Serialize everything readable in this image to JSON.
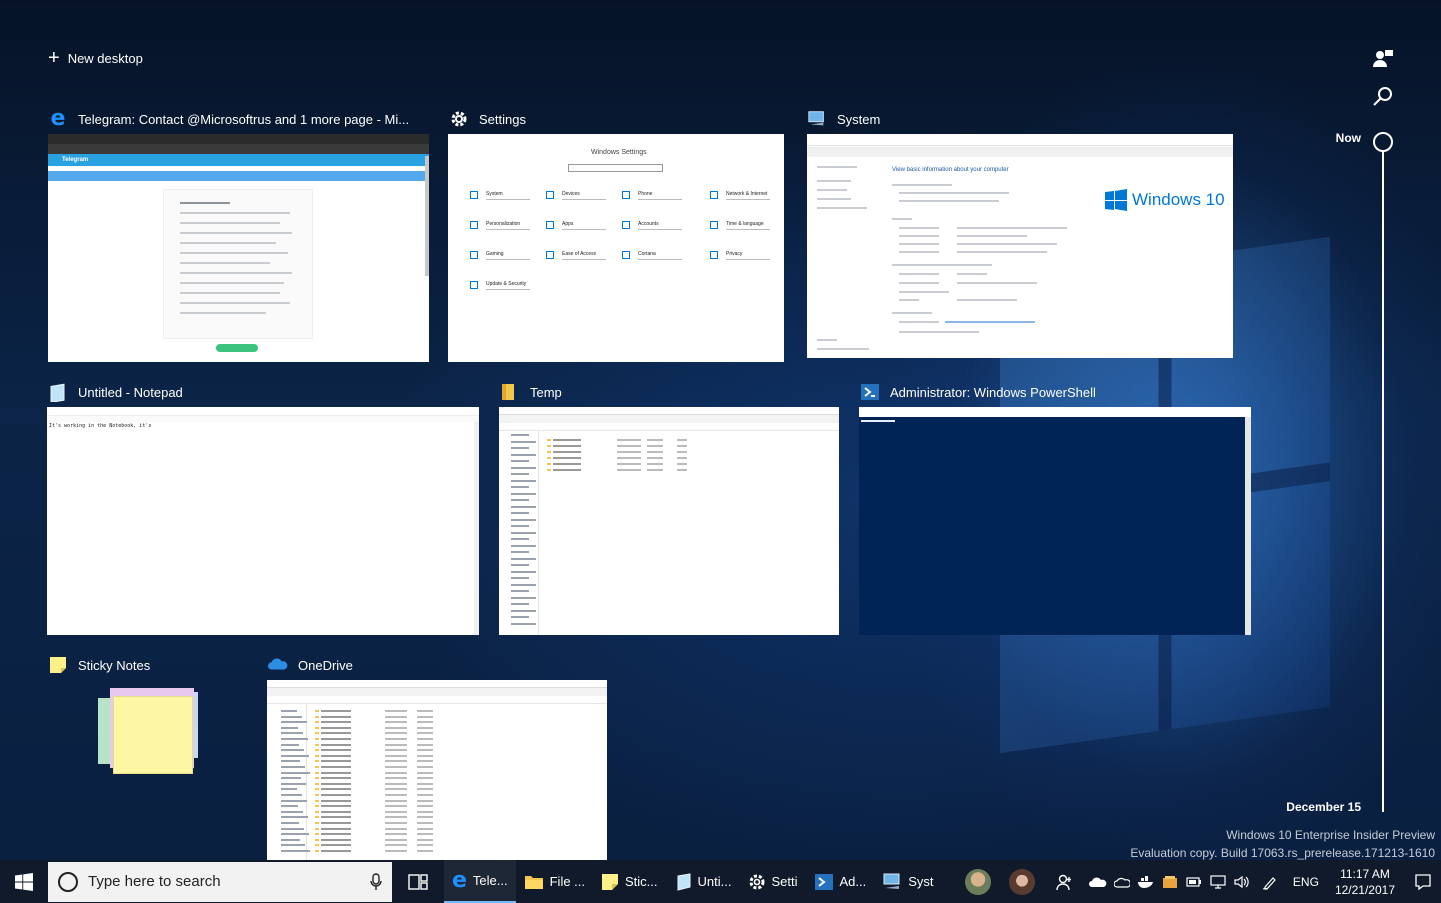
{
  "task_view": {
    "new_desktop_label": "New desktop"
  },
  "windows": [
    {
      "title": "Telegram: Contact @Microsoftrus and 1 more page - Mi...",
      "icon": "edge-icon"
    },
    {
      "title": "Settings",
      "icon": "gear-icon"
    },
    {
      "title": "System",
      "icon": "system-icon"
    },
    {
      "title": "Untitled - Notepad",
      "icon": "notepad-icon"
    },
    {
      "title": "Temp",
      "icon": "folder-icon"
    },
    {
      "title": "Administrator: Windows PowerShell",
      "icon": "powershell-icon"
    },
    {
      "title": "Sticky Notes",
      "icon": "sticky-notes-icon"
    },
    {
      "title": "OneDrive",
      "icon": "onedrive-icon"
    }
  ],
  "thumb_text": {
    "telegram_header": "Telegram",
    "settings_heading": "Windows Settings",
    "settings_items": [
      "System",
      "Devices",
      "Phone",
      "Network & Internet",
      "Personalization",
      "Apps",
      "Accounts",
      "Time & language",
      "Gaming",
      "Ease of Access",
      "Cortana",
      "Privacy",
      "Update & Security"
    ],
    "system_heading": "View basic information about your computer",
    "system_logo": "Windows 10",
    "notepad_text": "It's working in the Notebook, it's"
  },
  "timeline": {
    "now_label": "Now",
    "date_label": "December 15"
  },
  "watermark": {
    "line1": "Windows 10 Enterprise Insider Preview",
    "line2": "Evaluation copy. Build 17063.rs_prerelease.171213-1610"
  },
  "taskbar": {
    "search_placeholder": "Type here to search",
    "items": [
      {
        "label": "Tele...",
        "icon": "edge-icon",
        "active": true
      },
      {
        "label": "File ...",
        "icon": "folder-icon",
        "active": false
      },
      {
        "label": "Stic...",
        "icon": "sticky-notes-icon",
        "active": false
      },
      {
        "label": "Unti...",
        "icon": "notepad-icon",
        "active": false
      },
      {
        "label": "Setti",
        "icon": "gear-icon",
        "active": false
      },
      {
        "label": "Ad...",
        "icon": "powershell-icon",
        "active": false
      },
      {
        "label": "Syst",
        "icon": "system-icon",
        "active": false
      }
    ],
    "language": "ENG",
    "time": "11:17 AM",
    "date": "12/21/2017"
  },
  "colors": {
    "accent": "#0078d7",
    "powershell_bg": "#012456",
    "sticky": "#fdf6a3"
  }
}
